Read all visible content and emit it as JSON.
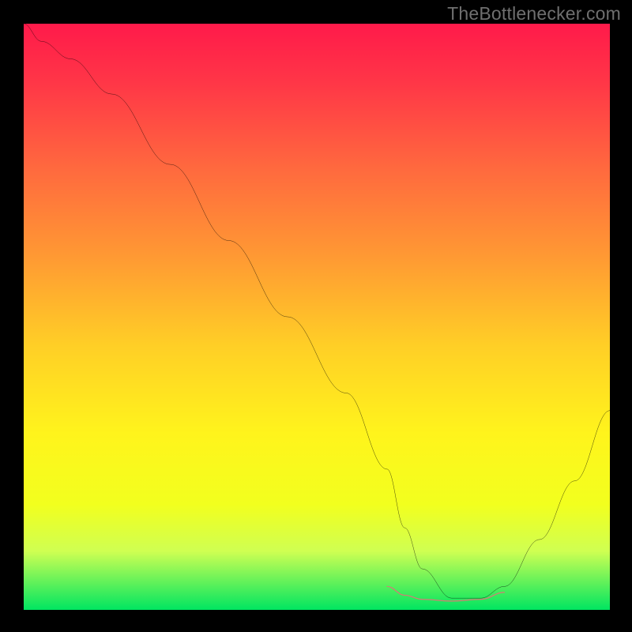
{
  "attribution": "TheBottlenecker.com",
  "chart_data": {
    "type": "line",
    "title": "",
    "xlabel": "",
    "ylabel": "",
    "xlim": [
      0,
      100
    ],
    "ylim": [
      0,
      100
    ],
    "gradient_stops": [
      {
        "offset": 0.0,
        "color": "#ff1a4a"
      },
      {
        "offset": 0.1,
        "color": "#ff3647"
      },
      {
        "offset": 0.25,
        "color": "#ff6a3e"
      },
      {
        "offset": 0.4,
        "color": "#ff9a33"
      },
      {
        "offset": 0.55,
        "color": "#ffcf26"
      },
      {
        "offset": 0.7,
        "color": "#fff41c"
      },
      {
        "offset": 0.82,
        "color": "#f2ff1e"
      },
      {
        "offset": 0.9,
        "color": "#cfff52"
      },
      {
        "offset": 1.0,
        "color": "#00e561"
      }
    ],
    "series": [
      {
        "name": "bottleneck_curve",
        "stroke": "#000000",
        "x": [
          0,
          3,
          8,
          15,
          25,
          35,
          45,
          55,
          62,
          65,
          68,
          73,
          78,
          82,
          88,
          94,
          100
        ],
        "y": [
          100,
          97,
          94,
          88,
          76,
          63,
          50,
          37,
          24,
          14,
          7,
          2,
          2,
          4,
          12,
          22,
          34
        ]
      },
      {
        "name": "optimal_band",
        "stroke": "#d77a76",
        "x": [
          62,
          65,
          68,
          73,
          78,
          82
        ],
        "y": [
          4,
          2.5,
          1.8,
          1.5,
          1.8,
          3
        ]
      }
    ]
  }
}
